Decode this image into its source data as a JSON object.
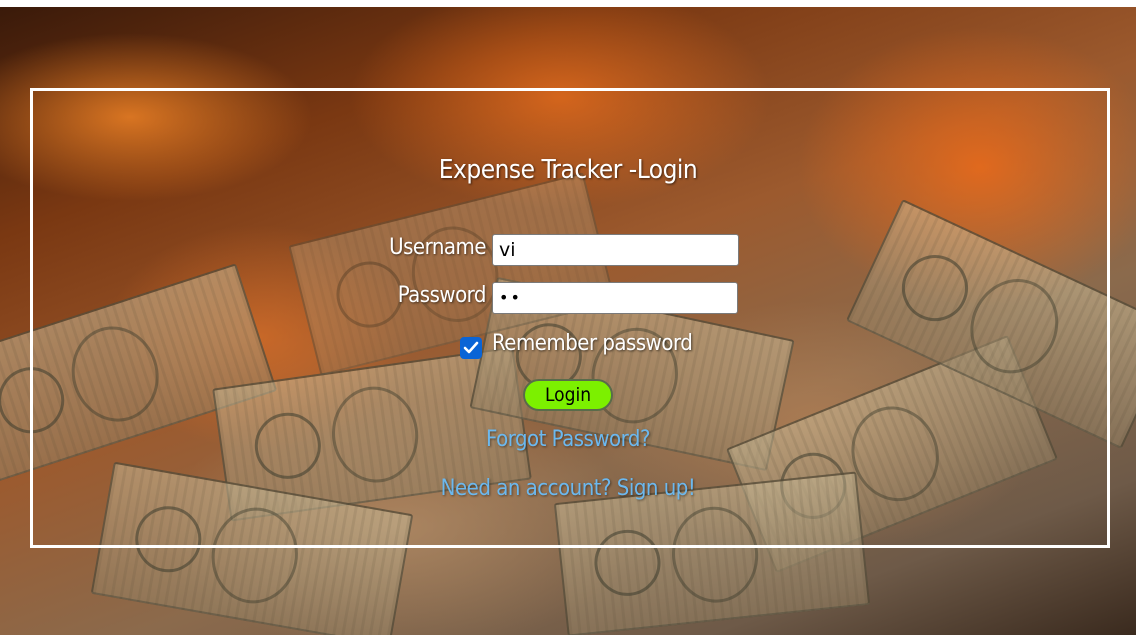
{
  "app": {
    "title": "Expense Tracker -Login"
  },
  "form": {
    "username_label": "Username",
    "username_value": "vi",
    "password_label": "Password",
    "password_value": "••",
    "remember_label": "Remember password",
    "remember_checked": true,
    "login_label": "Login"
  },
  "links": {
    "forgot_password": "Forgot Password?",
    "signup": "Need an account? Sign up!"
  },
  "colors": {
    "login_button": "#7cf000",
    "link": "#6cb8ee",
    "checkbox": "#0a64d6",
    "panel_border": "#ffffff"
  },
  "icons": {
    "checkbox": "checkmark-icon"
  }
}
